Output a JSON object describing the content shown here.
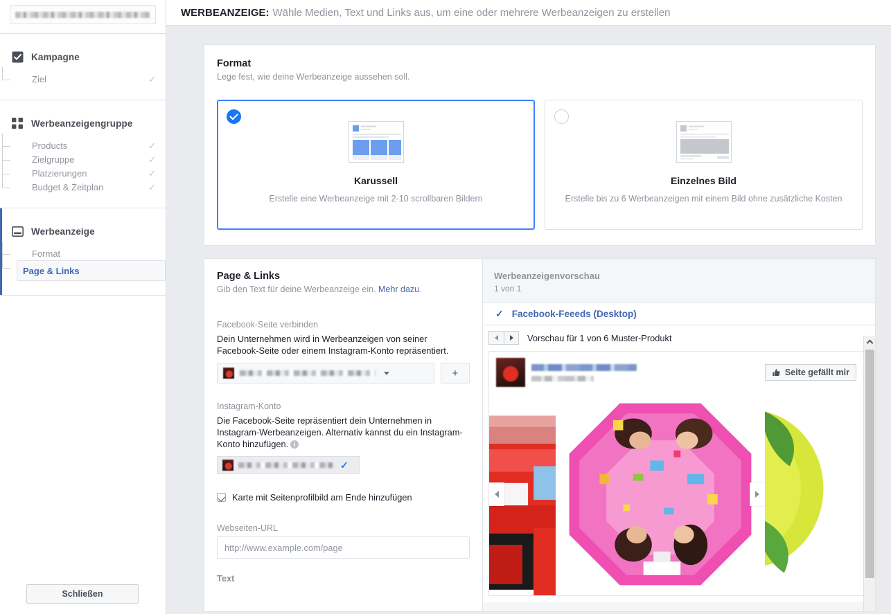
{
  "sidebar": {
    "account_field": {
      "name": "account-selector",
      "value": ""
    },
    "groups": [
      {
        "icon": "checkbox-checked-icon",
        "title": "Kampagne",
        "items": [
          {
            "label": "Ziel",
            "done": true,
            "selected": false
          }
        ]
      },
      {
        "icon": "grid-icon",
        "title": "Werbeanzeigengruppe",
        "items": [
          {
            "label": "Products",
            "done": true,
            "selected": false
          },
          {
            "label": "Zielgruppe",
            "done": true,
            "selected": false
          },
          {
            "label": "Platzierungen",
            "done": true,
            "selected": false
          },
          {
            "label": "Budget & Zeitplan",
            "done": true,
            "selected": false
          }
        ]
      },
      {
        "icon": "ad-window-icon",
        "title": "Werbeanzeige",
        "active": true,
        "items": [
          {
            "label": "Format",
            "done": false,
            "selected": false
          },
          {
            "label": "Page & Links",
            "done": false,
            "selected": true
          }
        ]
      }
    ],
    "close_button": "Schließen",
    "check_glyph": "✓"
  },
  "header": {
    "title": "WERBEANZEIGE:",
    "subtitle": "Wähle Medien, Text und Links aus, um eine oder mehrere Werbeanzeigen zu erstellen"
  },
  "format": {
    "title": "Format",
    "description": "Lege fest, wie deine Werbeanzeige aussehen soll.",
    "options": [
      {
        "name": "Karussell",
        "description": "Erstelle eine Werbeanzeige mit 2-10 scrollbaren Bildern",
        "selected": true,
        "icon": "carousel-layout-icon"
      },
      {
        "name": "Einzelnes Bild",
        "description": "Erstelle bis zu 6 Werbeanzeigen mit einem Bild ohne zusätzliche Kosten",
        "selected": false,
        "icon": "single-image-layout-icon"
      }
    ]
  },
  "page_links": {
    "title": "Page & Links",
    "description": "Gib den Text für deine Werbeanzeige ein.",
    "more_link": "Mehr dazu",
    "description_suffix": ".",
    "facebook_page": {
      "label": "Facebook-Seite verbinden",
      "help": "Dein Unternehmen wird in Werbeanzeigen von seiner Facebook-Seite oder einem Instagram-Konto repräsentiert.",
      "value": "",
      "add_button": "+"
    },
    "instagram": {
      "label": "Instagram-Konto",
      "help": "Die Facebook-Seite repräsentiert dein Unternehmen in Instagram-Werbeanzeigen. Alternativ kannst du ein Instagram-Konto hinzufügen.",
      "info_glyph": "i",
      "value": "",
      "check_glyph": "✓"
    },
    "profile_card_checkbox": {
      "label": "Karte mit Seitenprofilbild am Ende hinzufügen",
      "checked": true
    },
    "website_url": {
      "label": "Webseiten-URL",
      "placeholder": "http://www.example.com/page",
      "value": ""
    },
    "text_label": "Text"
  },
  "preview": {
    "title": "Werbeanzeigenvorschau",
    "count": "1 von 1",
    "tab": {
      "label": "Facebook-Feeeds (Desktop)",
      "check_glyph": "✓"
    },
    "nav": {
      "prev_icon": "triangle-left-icon",
      "next_icon": "triangle-right-icon",
      "caption": "Vorschau für 1 von 6 Muster-Produkt"
    },
    "ad": {
      "page_name": "",
      "meta": "",
      "like_button": "Seite gefällt mir",
      "like_icon": "thumbs-up-icon"
    },
    "carousel": {
      "prev_icon": "arrow-left-icon",
      "next_icon": "arrow-right-icon",
      "slides": [
        {
          "name": "red-toy-car-image"
        },
        {
          "name": "pink-umbrella-image"
        },
        {
          "name": "green-yellow-fruit-image"
        }
      ]
    },
    "scroll_up_icon": "chevron-up-icon"
  },
  "colors": {
    "accent_blue": "#1877f2",
    "link_blue": "#4267b2",
    "page_bg": "#e9ebee",
    "muted_text": "#90949c"
  }
}
